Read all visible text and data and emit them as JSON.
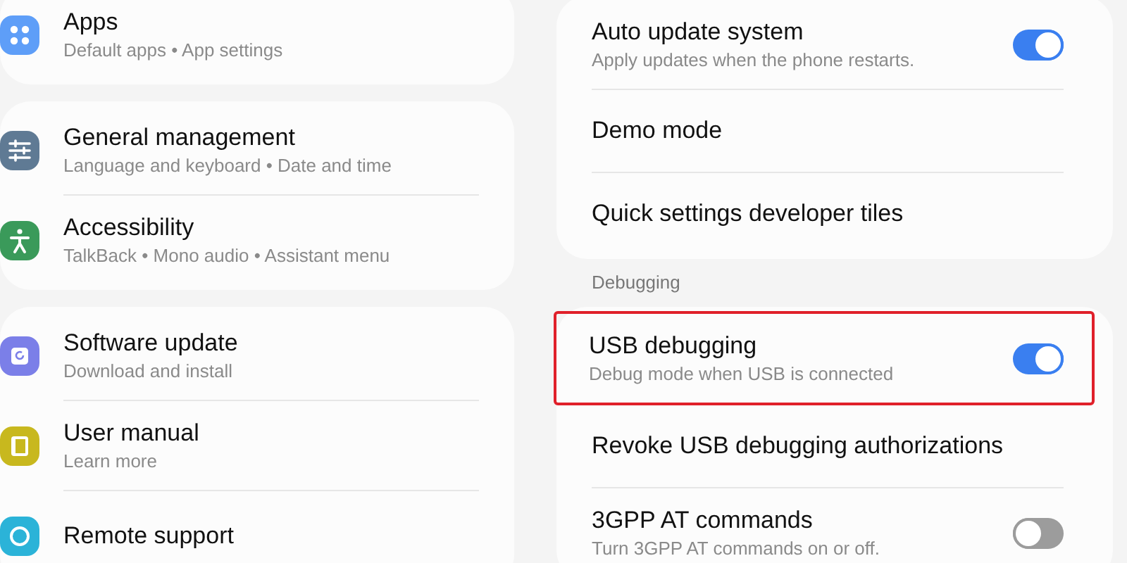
{
  "settings_menu": {
    "groups": [
      {
        "items": [
          {
            "kind": "apps",
            "color": "#5e9ef8",
            "title": "Apps",
            "subtitle": "Default apps • App settings"
          }
        ]
      },
      {
        "items": [
          {
            "kind": "sliders",
            "color": "#5f7a94",
            "title": "General management",
            "subtitle": "Language and keyboard • Date and time"
          },
          {
            "kind": "accessibility",
            "color": "#3a9a5a",
            "title": "Accessibility",
            "subtitle": "TalkBack • Mono audio • Assistant menu"
          }
        ]
      },
      {
        "items": [
          {
            "kind": "update",
            "color": "#7b7fe8",
            "title": "Software update",
            "subtitle": "Download and install"
          },
          {
            "kind": "manual",
            "color": "#c8b81e",
            "title": "User manual",
            "subtitle": "Learn more"
          },
          {
            "kind": "support",
            "color": "#2bb3d8",
            "title": "Remote support"
          }
        ]
      }
    ]
  },
  "developer_options": {
    "groups": [
      {
        "items": [
          {
            "kind": "toggle",
            "title": "Auto update system",
            "subtitle": "Apply updates when the phone restarts.",
            "on": true,
            "highlighted": false
          },
          {
            "kind": "plain",
            "title": "Demo mode",
            "highlighted": false
          },
          {
            "kind": "plain",
            "title": "Quick settings developer tiles",
            "highlighted": false
          }
        ]
      },
      {
        "header": "Debugging",
        "items": [
          {
            "kind": "toggle",
            "title": "USB debugging",
            "subtitle": "Debug mode when USB is connected",
            "on": true,
            "highlighted": true
          },
          {
            "kind": "plain",
            "title": "Revoke USB debugging authorizations",
            "highlighted": false
          },
          {
            "kind": "toggle",
            "title": "3GPP AT commands",
            "subtitle": "Turn 3GPP AT commands on or off.",
            "on": false,
            "highlighted": false
          }
        ]
      }
    ]
  }
}
